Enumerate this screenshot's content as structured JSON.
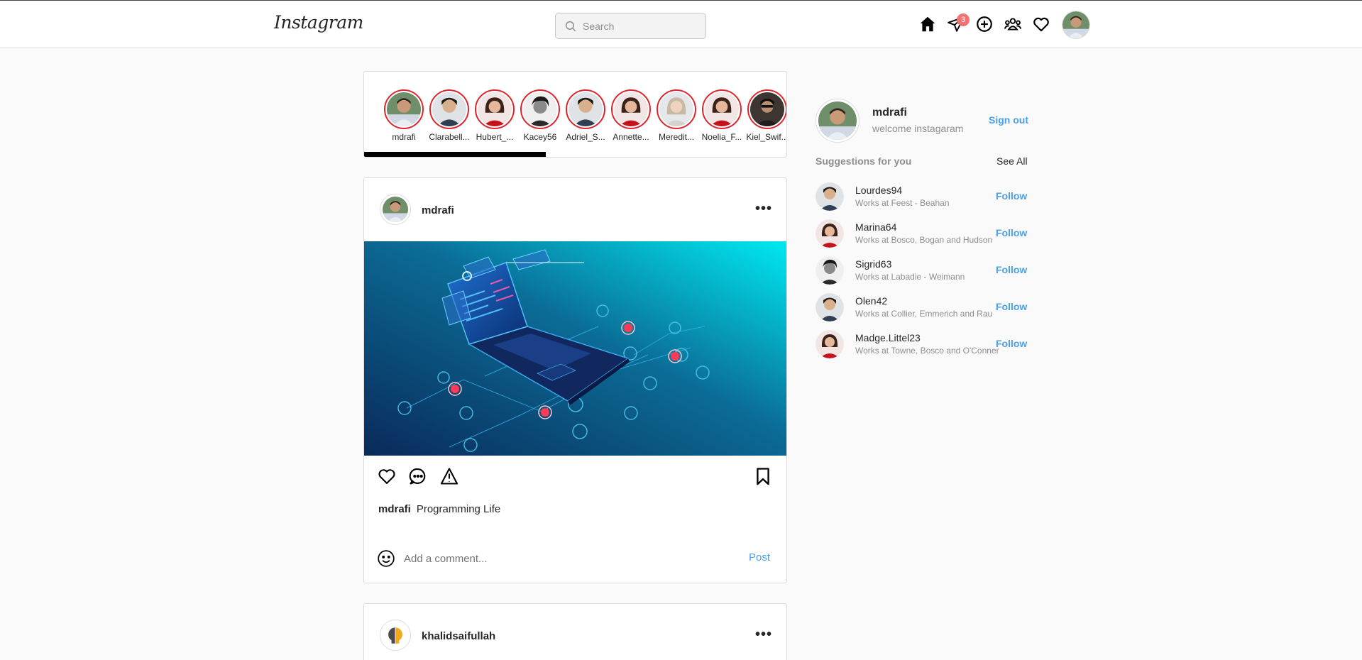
{
  "header": {
    "logo": "Instagram",
    "search_placeholder": "Search",
    "messages_badge": "3"
  },
  "stories": [
    {
      "label": "mdrafi"
    },
    {
      "label": "Clarabell..."
    },
    {
      "label": "Hubert_..."
    },
    {
      "label": "Kacey56"
    },
    {
      "label": "Adriel_S..."
    },
    {
      "label": "Annette..."
    },
    {
      "label": "Meredit..."
    },
    {
      "label": "Noelia_F..."
    },
    {
      "label": "Kiel_Swif..."
    }
  ],
  "posts": [
    {
      "username": "mdrafi",
      "more": "•••",
      "caption_user": "mdrafi",
      "caption_text": "Programming Life",
      "comment_placeholder": "Add a comment...",
      "post_label": "Post"
    },
    {
      "username": "khalidsaifullah",
      "more": "•••"
    }
  ],
  "sidebar": {
    "username": "mdrafi",
    "subtitle": "welcome instagaram",
    "signout": "Sign out",
    "suggestions_title": "Suggestions for you",
    "see_all": "See All",
    "follow_label": "Follow",
    "suggestions": [
      {
        "name": "Lourdes94",
        "sub": "Works at Feest - Beahan"
      },
      {
        "name": "Marina64",
        "sub": "Works at Bosco, Bogan and Hudson"
      },
      {
        "name": "Sigrid63",
        "sub": "Works at Labadie - Weimann"
      },
      {
        "name": "Olen42",
        "sub": "Works at Collier, Emmerich and Rau"
      },
      {
        "name": "Madge.Littel23",
        "sub": "Works at Towne, Bosco and O'Conner"
      }
    ]
  },
  "colors": {
    "accent_blue": "#4aa0e8",
    "story_ring": "#e0242e",
    "badge": "#f27272"
  }
}
